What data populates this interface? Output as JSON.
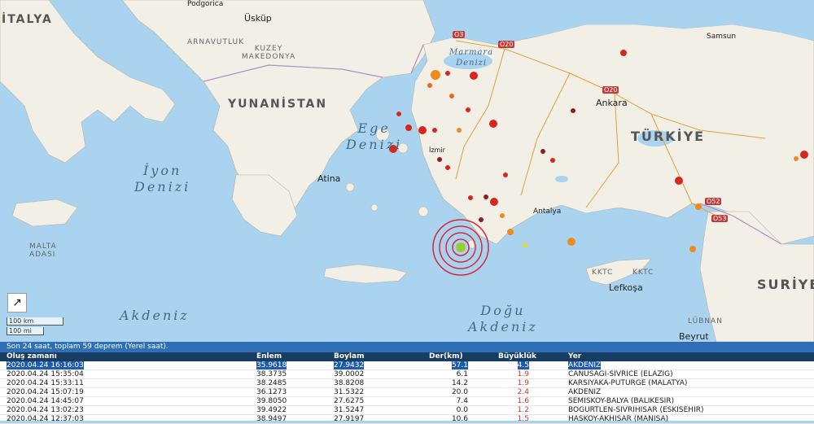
{
  "map": {
    "countries": [
      "İTALYA",
      "YUNANİSTAN",
      "TÜRKİYE",
      "SURİYE",
      "ARNAVUTLUK",
      "KUZEY MAKEDONYA",
      "MALTA",
      "ADASI",
      "KKTC",
      "KKTC",
      "LÜBNAN"
    ],
    "seas": {
      "ege": [
        "Ege",
        "Denizi"
      ],
      "iyon": [
        "İyon",
        "Denizi"
      ],
      "akdeniz": "Akdeniz",
      "dogu": [
        "Doğu",
        "Akdeniz"
      ],
      "marmara": [
        "Marmara",
        "Denizi"
      ]
    },
    "cities": [
      "Üsküp",
      "Atina",
      "Ankara",
      "Antalya",
      "Lefkoşa",
      "Beyrut",
      "İzmir",
      "Samsun",
      "Podgorica"
    ],
    "roads": [
      "O3",
      "O20",
      "O52",
      "O53",
      "O20"
    ],
    "scale": {
      "km": "100 km",
      "mi": "100 mi"
    },
    "expand_icon": "expand-arrow-icon",
    "highlight_color": "#c0392b"
  },
  "panel": {
    "summary": "Son 24 saat, toplam 59 deprem (Yerel saat).",
    "columns": [
      "Oluş zamanı",
      "Enlem",
      "Boylam",
      "Der(km)",
      "Büyüklük",
      "Yer"
    ],
    "rows": [
      [
        "2020.04.24 16:16:03",
        "35.9618",
        "27.9432",
        "57.1",
        "4.5",
        "AKDENIZ"
      ],
      [
        "2020.04.24 15:35:04",
        "38.3735",
        "39.0002",
        "6.1",
        "1.9",
        "CANUSAGI-SIVRICE (ELAZIG)"
      ],
      [
        "2020.04.24 15:33:11",
        "38.2485",
        "38.8208",
        "14.2",
        "1.9",
        "KARSIYAKA-PUTURGE (MALATYA)"
      ],
      [
        "2020.04.24 15:07:19",
        "36.1273",
        "31.5322",
        "20.0",
        "2.4",
        "AKDENIZ"
      ],
      [
        "2020.04.24 14:45:07",
        "39.8050",
        "27.6275",
        "7.4",
        "1.6",
        "SEMISKOY-BALYA (BALIKESIR)"
      ],
      [
        "2020.04.24 13:02:23",
        "39.4922",
        "31.5247",
        "0.0",
        "1.2",
        "BOGURTLEN-SIVRIHISAR (ESKISEHIR)"
      ],
      [
        "2020.04.24 12:37:03",
        "38.9497",
        "27.9197",
        "10.6",
        "1.5",
        "HASKOY-AKHISAR (MANISA)"
      ]
    ]
  }
}
